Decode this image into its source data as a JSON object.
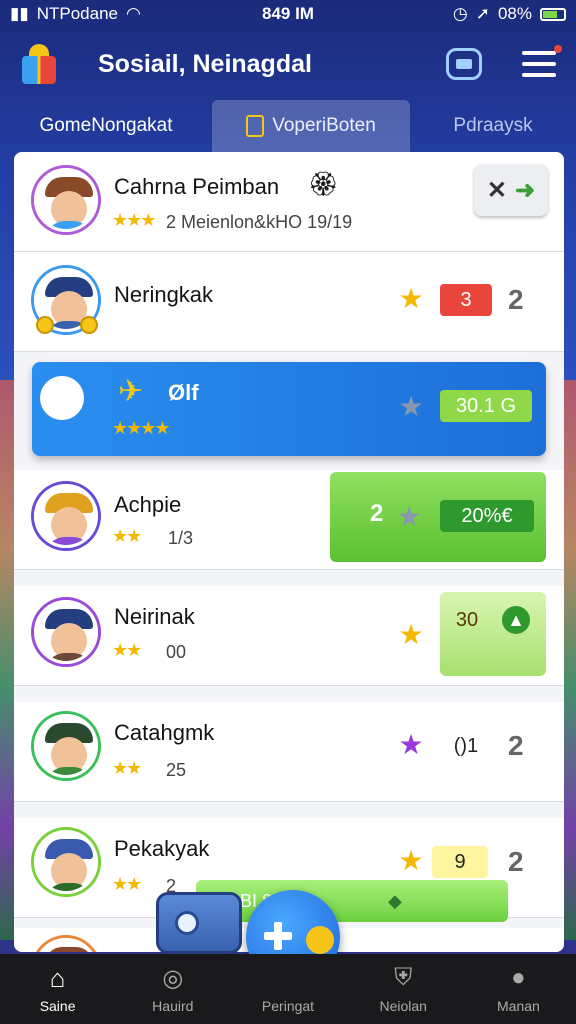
{
  "status_bar": {
    "carrier": "NTPodane",
    "time": "849 IM",
    "battery": "08%"
  },
  "header": {
    "title": "Sosiail, Neinagdal"
  },
  "tabs": [
    {
      "label": "GomeNongakat"
    },
    {
      "label": "VoperiBoten"
    },
    {
      "label": "Pdraaysk"
    }
  ],
  "top_player": {
    "name": "Cahrna Peimban",
    "stars": "★★★",
    "sub": "2 Meienlon&kHO 19/19",
    "action": "✕"
  },
  "rows": [
    {
      "name": "Neringkak",
      "stars": "",
      "sub": "",
      "score": "3",
      "rank": "2"
    },
    {
      "name": "Ølf",
      "stars": "★★★★",
      "sub": "",
      "score": "30.1 G",
      "rank": ""
    },
    {
      "name": "Achpie",
      "stars": "★★",
      "sub": "1/3",
      "score": "20%€",
      "rank": "",
      "left_value": "2"
    },
    {
      "name": "Neirinak",
      "stars": "★★",
      "sub": "00",
      "score": "30",
      "rank": ""
    },
    {
      "name": "Catahgmk",
      "stars": "★★",
      "sub": "25",
      "score": "()1",
      "rank": "2"
    },
    {
      "name": "Pekakyak",
      "stars": "★★",
      "sub": "2",
      "score": "9",
      "rank": "2"
    }
  ],
  "float_bar": {
    "label": "BI 881%"
  },
  "bottom_nav": [
    {
      "label": "Saine"
    },
    {
      "label": "Hauird"
    },
    {
      "label": "Peringat"
    },
    {
      "label": "Neiolan"
    },
    {
      "label": "Manan"
    }
  ],
  "colors": {
    "accent_blue": "#1d6fd8",
    "accent_green": "#5cc030",
    "badge_red": "#e8463a",
    "star_gold": "#f5b800"
  }
}
